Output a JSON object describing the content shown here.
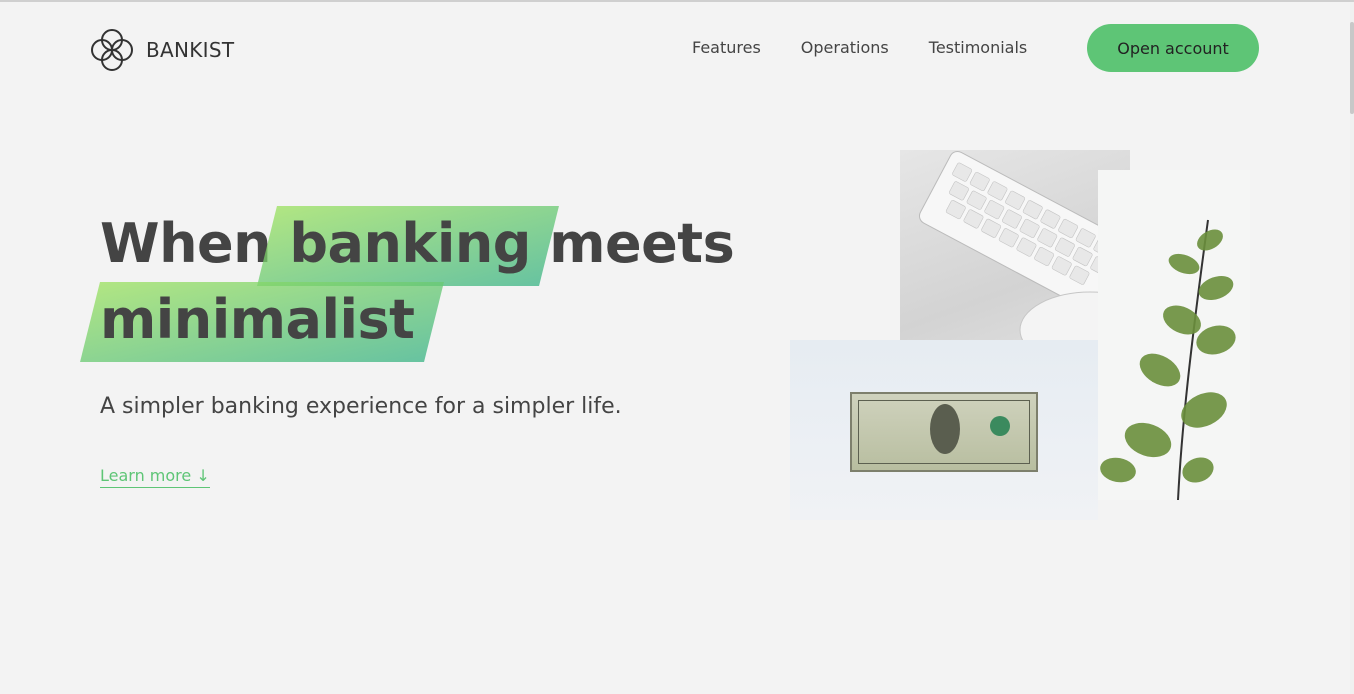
{
  "brand": {
    "name": "BANKIST",
    "accent": "#5ec576"
  },
  "nav": {
    "links": [
      "Features",
      "Operations",
      "Testimonials"
    ],
    "cta": "Open account"
  },
  "hero": {
    "title_word_1": "When",
    "title_highlight_1": "banking",
    "title_word_2": "meets",
    "title_highlight_2": "minimalist",
    "subtitle": "A simpler banking experience for a simpler life.",
    "learn_more": "Learn more ↓"
  },
  "images": {
    "collage_icons": [
      "keyboard-mouse-photo",
      "dollar-bill-photo",
      "eucalyptus-plant-photo"
    ]
  }
}
